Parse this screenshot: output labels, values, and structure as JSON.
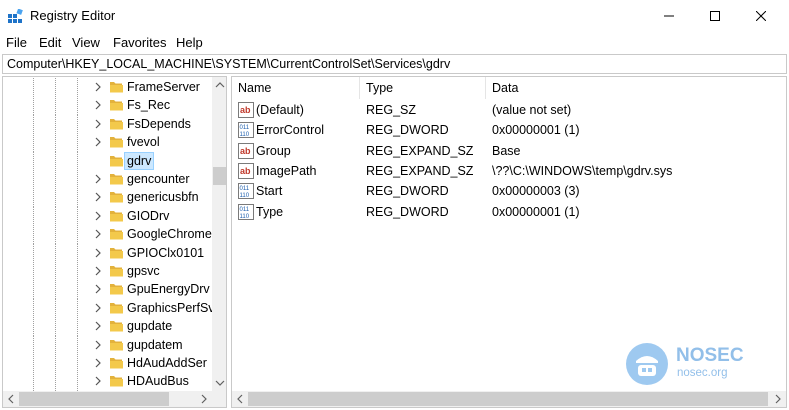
{
  "window": {
    "title": "Registry Editor"
  },
  "menu": [
    "File",
    "Edit",
    "View",
    "Favorites",
    "Help"
  ],
  "address": "Computer\\HKEY_LOCAL_MACHINE\\SYSTEM\\CurrentControlSet\\Services\\gdrv",
  "tree": {
    "items": [
      {
        "label": "FrameServer",
        "expandable": true,
        "selected": false
      },
      {
        "label": "Fs_Rec",
        "expandable": true,
        "selected": false
      },
      {
        "label": "FsDepends",
        "expandable": true,
        "selected": false
      },
      {
        "label": "fvevol",
        "expandable": true,
        "selected": false
      },
      {
        "label": "gdrv",
        "expandable": false,
        "selected": true
      },
      {
        "label": "gencounter",
        "expandable": true,
        "selected": false
      },
      {
        "label": "genericusbfn",
        "expandable": true,
        "selected": false
      },
      {
        "label": "GIODrv",
        "expandable": true,
        "selected": false
      },
      {
        "label": "GoogleChrome",
        "expandable": true,
        "selected": false
      },
      {
        "label": "GPIOClx0101",
        "expandable": true,
        "selected": false
      },
      {
        "label": "gpsvc",
        "expandable": true,
        "selected": false
      },
      {
        "label": "GpuEnergyDrv",
        "expandable": true,
        "selected": false
      },
      {
        "label": "GraphicsPerfSv",
        "expandable": true,
        "selected": false
      },
      {
        "label": "gupdate",
        "expandable": true,
        "selected": false
      },
      {
        "label": "gupdatem",
        "expandable": true,
        "selected": false
      },
      {
        "label": "HdAudAddSer",
        "expandable": true,
        "selected": false
      },
      {
        "label": "HDAudBus",
        "expandable": true,
        "selected": false
      }
    ]
  },
  "list": {
    "columns": [
      "Name",
      "Type",
      "Data"
    ],
    "rows": [
      {
        "icon": "string-value-icon",
        "name": "(Default)",
        "type": "REG_SZ",
        "data": "(value not set)"
      },
      {
        "icon": "binary-value-icon",
        "name": "ErrorControl",
        "type": "REG_DWORD",
        "data": "0x00000001 (1)"
      },
      {
        "icon": "string-value-icon",
        "name": "Group",
        "type": "REG_EXPAND_SZ",
        "data": "Base"
      },
      {
        "icon": "string-value-icon",
        "name": "ImagePath",
        "type": "REG_EXPAND_SZ",
        "data": "\\??\\C:\\WINDOWS\\temp\\gdrv.sys"
      },
      {
        "icon": "binary-value-icon",
        "name": "Start",
        "type": "REG_DWORD",
        "data": "0x00000003 (3)"
      },
      {
        "icon": "binary-value-icon",
        "name": "Type",
        "type": "REG_DWORD",
        "data": "0x00000001 (1)"
      }
    ]
  },
  "watermark": {
    "brand": "NOSEC",
    "domain": "nosec.org"
  },
  "colors": {
    "selection": "#cce8ff",
    "folder": "#f3c94b",
    "accent": "#0078d7",
    "watermark": "#7fb4e6"
  }
}
